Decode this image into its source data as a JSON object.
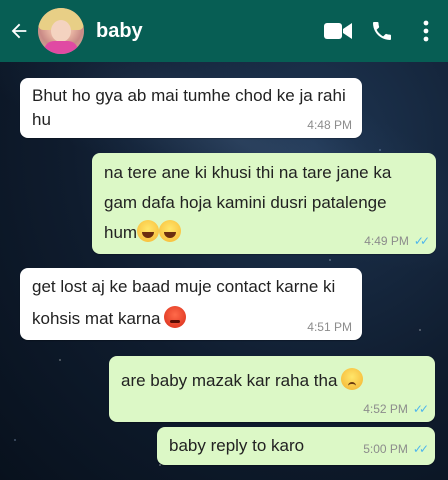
{
  "header": {
    "back_icon": "arrow-left-icon",
    "contact_name": "baby",
    "avatar_icon": "contact-avatar",
    "video_icon": "video-camera-icon",
    "call_icon": "phone-icon",
    "menu_icon": "more-vertical-icon",
    "bar_color": "#075e54"
  },
  "messages": [
    {
      "direction": "incoming",
      "text": "Bhut ho gya ab mai tumhe chod ke ja rahi hu",
      "time": "4:48 PM"
    },
    {
      "direction": "outgoing",
      "text": "na tere ane ki khusi thi na tare jane ka gam dafa hoja kamini dusri patalenge hum",
      "emoji": "laughing-tears-emoji x2",
      "time": "4:49 PM",
      "status": "read"
    },
    {
      "direction": "incoming",
      "text": "get lost aj ke baad muje contact karne ki kohsis mat karna",
      "emoji": "angry-face-emoji",
      "time": "4:51 PM"
    },
    {
      "direction": "outgoing",
      "text": "are baby mazak kar raha tha",
      "emoji": "sad-face-emoji",
      "time": "4:52 PM",
      "status": "read"
    },
    {
      "direction": "outgoing",
      "text": "baby reply to karo",
      "time": "5:00 PM",
      "status": "read"
    }
  ],
  "colors": {
    "incoming_bubble": "#ffffff",
    "outgoing_bubble": "#dcf8c6",
    "read_ticks": "#4fb6ec",
    "timestamp": "#8c8c8c"
  }
}
